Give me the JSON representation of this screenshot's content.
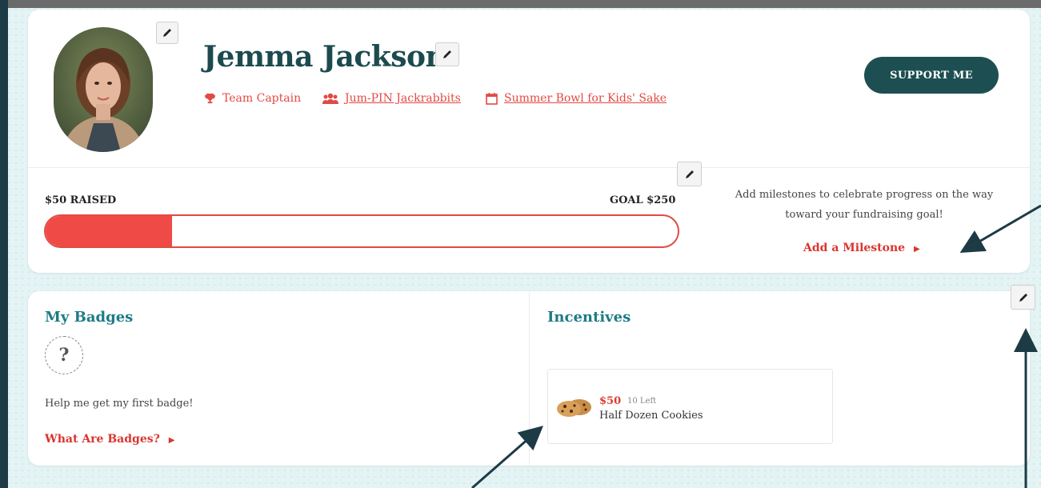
{
  "profile": {
    "name": "Jemma Jackson",
    "role": "Team Captain",
    "team": "Jum-PIN Jackrabbits",
    "event": "Summer Bowl for Kids' Sake",
    "support_button": "SUPPORT ME"
  },
  "progress": {
    "raised_label": "$50 RAISED",
    "goal_label": "GOAL $250",
    "fraction": 0.2
  },
  "milestones": {
    "message": "Add milestones to celebrate progress on the way toward your fundraising goal!",
    "link_label": "Add a Milestone"
  },
  "badges": {
    "title": "My Badges",
    "placeholder_glyph": "?",
    "help_text": "Help me get my first badge!",
    "link_label": "What Are Badges?"
  },
  "incentives": {
    "title": "Incentives",
    "items": [
      {
        "price": "$50",
        "remaining": "10 Left",
        "name": "Half Dozen Cookies",
        "icon": "cookie-icon"
      }
    ]
  },
  "colors": {
    "accent_red": "#e24a45",
    "dark_teal": "#1d4f52",
    "title_teal": "#1d7b86",
    "name_color": "#1c4b4f"
  }
}
